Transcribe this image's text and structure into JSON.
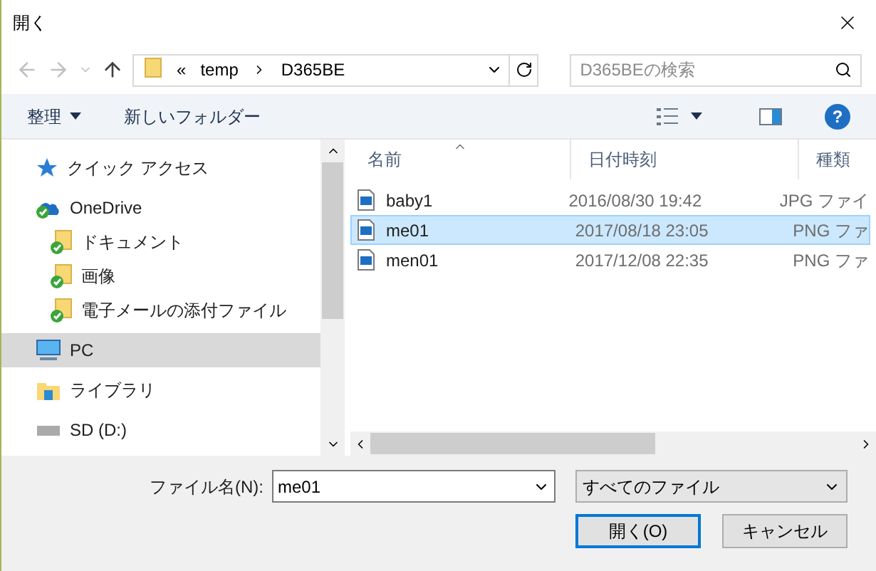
{
  "window": {
    "title": "開く"
  },
  "address": {
    "overflow": "«",
    "path": [
      "temp",
      "D365BE"
    ]
  },
  "search": {
    "placeholder": "D365BEの検索"
  },
  "help": {
    "glyph": "?"
  },
  "toolbar": [
    {
      "label": "整理",
      "dropdown": true
    },
    {
      "label": "新しいフォルダー",
      "dropdown": false
    }
  ],
  "nav": [
    {
      "label": "クイック アクセス",
      "kind": "star",
      "selected": false
    },
    {
      "label": "OneDrive",
      "kind": "cloud",
      "selected": false,
      "synced": true,
      "children": [
        {
          "label": "ドキュメント",
          "kind": "folder",
          "selected": false,
          "synced": true
        },
        {
          "label": "画像",
          "kind": "folder",
          "selected": false,
          "synced": true
        },
        {
          "label": "電子メールの添付ファイル",
          "kind": "folder",
          "selected": false,
          "synced": true
        }
      ]
    },
    {
      "label": "PC",
      "kind": "pc",
      "selected": true
    },
    {
      "label": "ライブラリ",
      "kind": "library",
      "selected": false
    },
    {
      "label": "SD (D:)",
      "kind": "drive",
      "selected": false
    }
  ],
  "columns": [
    {
      "label": "名前",
      "sorted": true
    },
    {
      "label": "日付時刻",
      "sorted": false
    },
    {
      "label": "種類",
      "sorted": false
    }
  ],
  "files": [
    {
      "name": "baby1",
      "date": "2016/08/30 19:42",
      "type": "JPG ファイ",
      "selected": false
    },
    {
      "name": "me01",
      "date": "2017/08/18 23:05",
      "type": "PNG ファ",
      "selected": true
    },
    {
      "name": "men01",
      "date": "2017/12/08 22:35",
      "type": "PNG ファ",
      "selected": false
    }
  ],
  "filename": {
    "label": "ファイル名(N):",
    "value": "me01"
  },
  "filter": {
    "value": "すべてのファイル"
  },
  "buttons": [
    {
      "label": "開く(O)",
      "default": true
    },
    {
      "label": "キャンセル",
      "default": false
    }
  ]
}
